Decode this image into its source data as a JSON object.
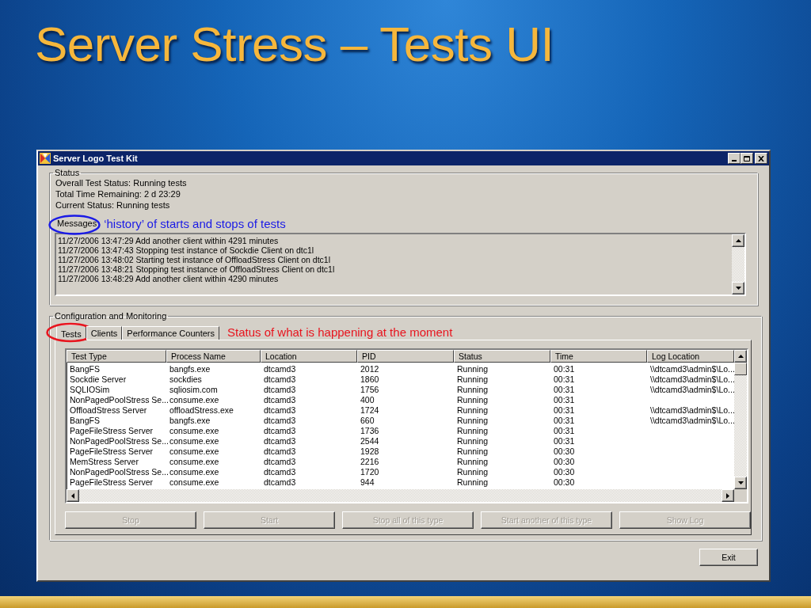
{
  "slide": {
    "title": "Server Stress – Tests UI"
  },
  "window": {
    "title": "Server Logo Test Kit"
  },
  "status": {
    "label": "Status",
    "lines": [
      "Overall Test Status: Running tests",
      "Total Time Remaining: 2 d 23:29",
      "Current Status: Running tests"
    ]
  },
  "messages": {
    "label": "Messages",
    "annotation": "‘history’ of starts and stops of tests",
    "lines": [
      "11/27/2006 13:47:29 Add another client within 4291 minutes",
      "11/27/2006 13:47:43 Stopping test instance of Sockdie Client on dtc1l",
      "11/27/2006 13:48:02 Starting test instance of OffloadStress Client on dtc1l",
      "11/27/2006 13:48:21 Stopping test instance of OffloadStress Client on dtc1l",
      "11/27/2006 13:48:29 Add another client within 4290 minutes"
    ]
  },
  "config": {
    "label": "Configuration and Monitoring",
    "annotation": "Status of what is happening at the moment",
    "tabs": [
      {
        "label": "Tests",
        "selected": true
      },
      {
        "label": "Clients",
        "selected": false
      },
      {
        "label": "Performance Counters",
        "selected": false
      }
    ]
  },
  "table": {
    "columns": [
      "Test Type",
      "Process Name",
      "Location",
      "PID",
      "Status",
      "Time",
      "Log Location"
    ],
    "rows": [
      [
        "BangFS",
        "bangfs.exe",
        "dtcamd3",
        "2012",
        "Running",
        "00:31",
        "\\\\dtcamd3\\admin$\\Lo..."
      ],
      [
        "Sockdie Server",
        "sockdies",
        "dtcamd3",
        "1860",
        "Running",
        "00:31",
        "\\\\dtcamd3\\admin$\\Lo..."
      ],
      [
        "SQLIOSim",
        "sqliosim.com",
        "dtcamd3",
        "1756",
        "Running",
        "00:31",
        "\\\\dtcamd3\\admin$\\Lo..."
      ],
      [
        "NonPagedPoolStress Se...",
        "consume.exe",
        "dtcamd3",
        "400",
        "Running",
        "00:31",
        ""
      ],
      [
        "OffloadStress Server",
        "offloadStress.exe",
        "dtcamd3",
        "1724",
        "Running",
        "00:31",
        "\\\\dtcamd3\\admin$\\Lo..."
      ],
      [
        "BangFS",
        "bangfs.exe",
        "dtcamd3",
        "660",
        "Running",
        "00:31",
        "\\\\dtcamd3\\admin$\\Lo..."
      ],
      [
        "PageFileStress Server",
        "consume.exe",
        "dtcamd3",
        "1736",
        "Running",
        "00:31",
        ""
      ],
      [
        "NonPagedPoolStress Se...",
        "consume.exe",
        "dtcamd3",
        "2544",
        "Running",
        "00:31",
        ""
      ],
      [
        "PageFileStress Server",
        "consume.exe",
        "dtcamd3",
        "1928",
        "Running",
        "00:30",
        ""
      ],
      [
        "MemStress Server",
        "consume.exe",
        "dtcamd3",
        "2216",
        "Running",
        "00:30",
        ""
      ],
      [
        "NonPagedPoolStress Se...",
        "consume.exe",
        "dtcamd3",
        "1720",
        "Running",
        "00:30",
        ""
      ],
      [
        "PageFileStress Server",
        "consume.exe",
        "dtcamd3",
        "944",
        "Running",
        "00:30",
        ""
      ]
    ]
  },
  "buttons": [
    {
      "label": "Stop",
      "disabled": true
    },
    {
      "label": "Start",
      "disabled": true
    },
    {
      "label": "Stop all of this type",
      "disabled": true
    },
    {
      "label": "Start another of this type",
      "disabled": true
    },
    {
      "label": "Show Log",
      "disabled": true
    }
  ],
  "exit_button": {
    "label": "Exit",
    "disabled": false
  }
}
